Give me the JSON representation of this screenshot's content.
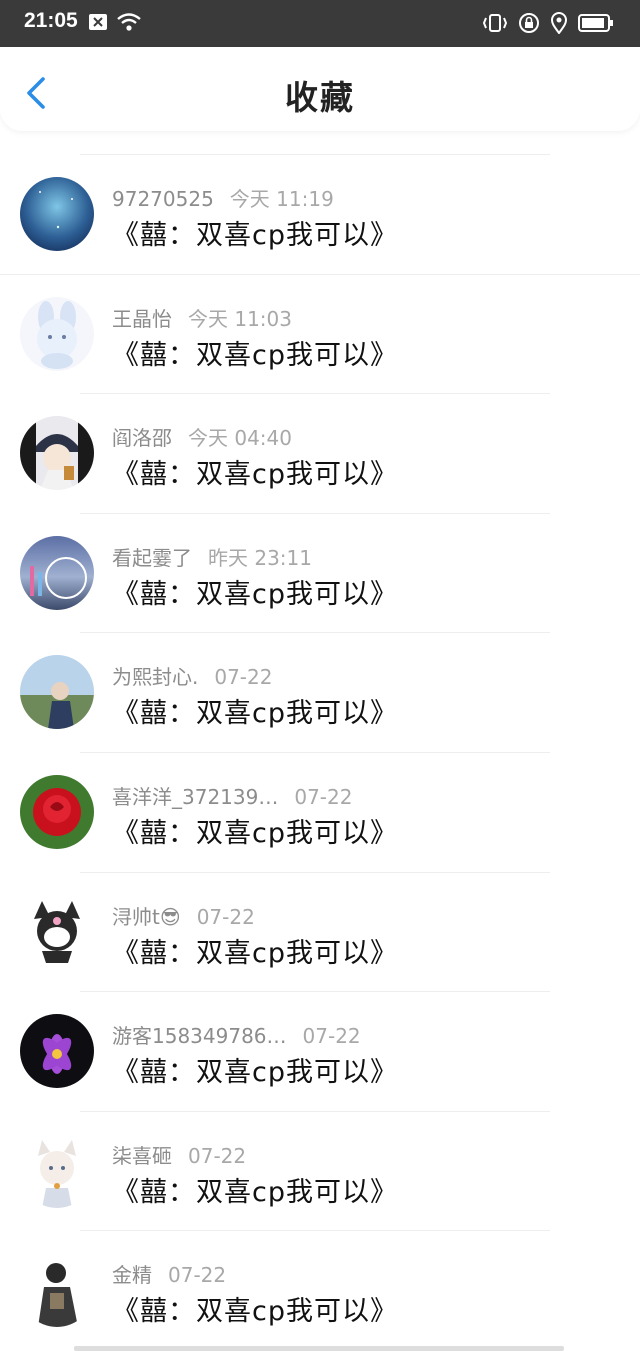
{
  "status_bar": {
    "time": "21:05",
    "left_icons": [
      "close-box-icon",
      "wifi-icon"
    ],
    "right_icons": [
      "vibrate-icon",
      "lock-rotation-icon",
      "location-icon",
      "battery-icon"
    ]
  },
  "header": {
    "title": "收藏"
  },
  "items": [
    {
      "name": "97270525",
      "time": "今天 11:19",
      "content": "《囍：双喜cp我可以》",
      "avatar": "galaxy-avatar"
    },
    {
      "name": "王晶怡",
      "time": "今天 11:03",
      "content": "《囍：双喜cp我可以》",
      "avatar": "bunny-avatar"
    },
    {
      "name": "阎洛邵",
      "time": "今天 04:40",
      "content": "《囍：双喜cp我可以》",
      "avatar": "anime-boy-avatar"
    },
    {
      "name": "看起霎了",
      "time": "昨天 23:11",
      "content": "《囍：双喜cp我可以》",
      "avatar": "night-scene-avatar"
    },
    {
      "name": "为熙封心.",
      "time": "07-22",
      "content": "《囍：双喜cp我可以》",
      "avatar": "field-person-avatar"
    },
    {
      "name": "喜洋洋_372139…",
      "time": "07-22",
      "content": "《囍：双喜cp我可以》",
      "avatar": "rose-avatar"
    },
    {
      "name": "浔帅t😎",
      "time": "07-22",
      "content": "《囍：双喜cp我可以》",
      "avatar": "kuromi-avatar"
    },
    {
      "name": "游客158349786…",
      "time": "07-22",
      "content": "《囍：双喜cp我可以》",
      "avatar": "lotus-avatar"
    },
    {
      "name": "柒喜砸",
      "time": "07-22",
      "content": "《囍：双喜cp我可以》",
      "avatar": "cat-boy-avatar"
    },
    {
      "name": "金精",
      "time": "07-22",
      "content": "《囍：双喜cp我可以》",
      "avatar": "dark-figure-avatar"
    }
  ],
  "colors": {
    "status_bar_bg": "#3a3a3a",
    "accent_blue": "#2b8de8",
    "meta_gray": "#8c8c8c",
    "separator": "#eeeeee"
  }
}
